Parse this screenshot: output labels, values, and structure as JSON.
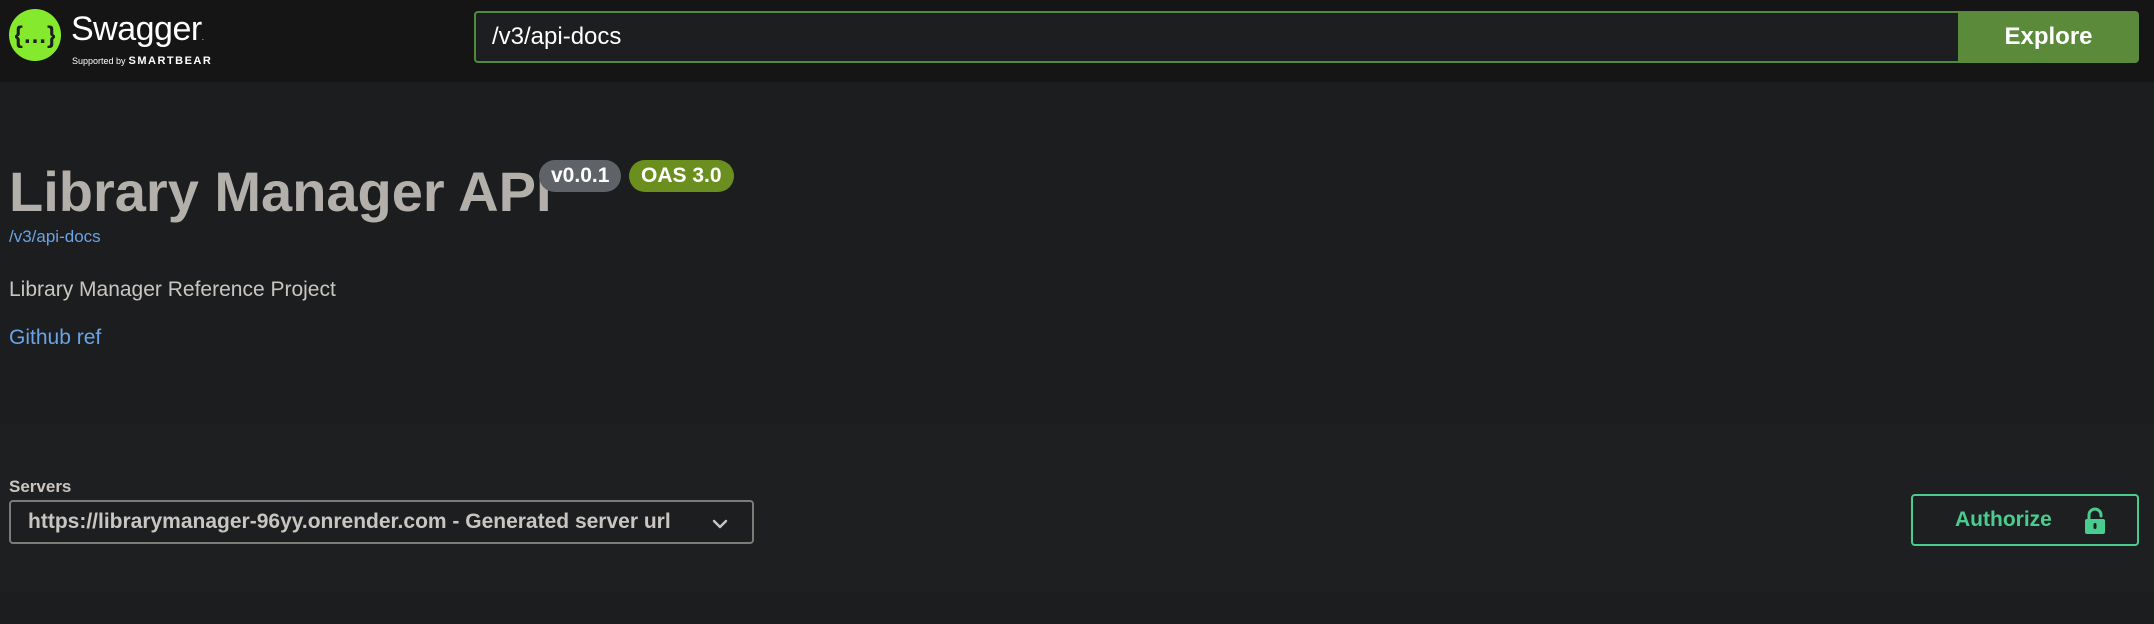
{
  "topbar": {
    "logo_wordmark": "Swagger",
    "logo_tm": ".",
    "logo_supported": "Supported by",
    "logo_brand": "SMARTBEAR",
    "url_value": "/v3/api-docs",
    "explore_label": "Explore"
  },
  "info": {
    "title": "Library Manager API",
    "version_badge": "v0.0.1",
    "oas_badge": "OAS 3.0",
    "spec_link": "/v3/api-docs",
    "description": "Library Manager Reference Project",
    "github_link": "Github ref"
  },
  "servers": {
    "label": "Servers",
    "selected": "https://librarymanager-96yy.onrender.com - Generated server url"
  },
  "authorize": {
    "label": "Authorize"
  },
  "icons": {
    "logo": "swagger-logo-icon",
    "chevron": "chevron-down-icon",
    "lock": "unlocked-padlock-icon"
  },
  "colors": {
    "accent_green": "#85ea2d",
    "explore_bg": "#5c8a3b",
    "link_blue": "#6aa3e6",
    "authorize_green": "#49cc90",
    "oas_badge": "#6b8f1f",
    "version_badge": "#5f6266"
  }
}
